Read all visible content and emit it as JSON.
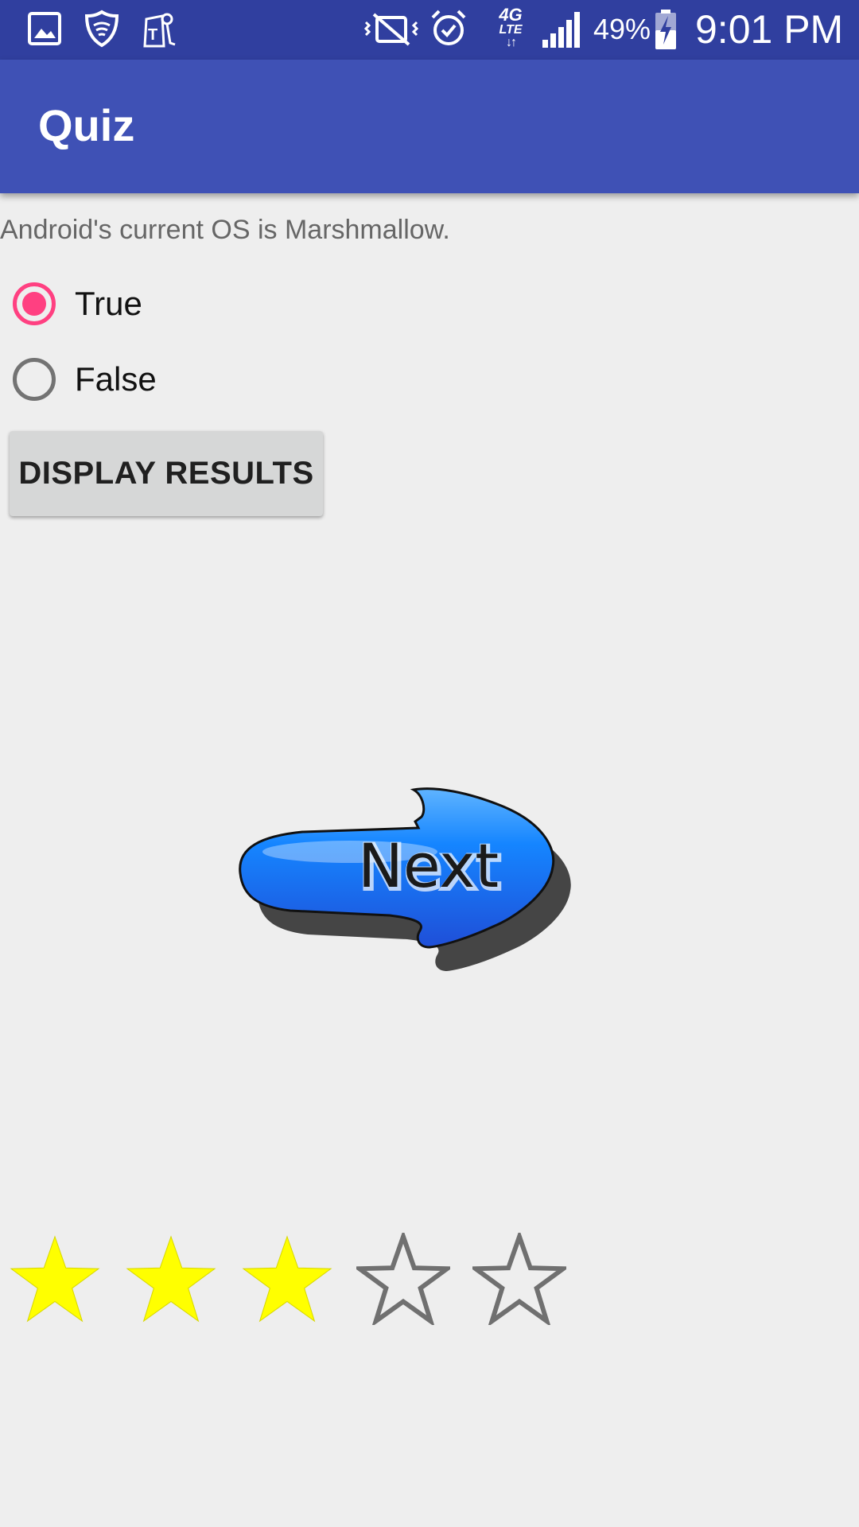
{
  "status_bar": {
    "battery_percent": "49%",
    "time": "9:01 PM",
    "network_label_top": "4G",
    "network_label_bottom": "LTE",
    "icons": [
      "gallery-icon",
      "lookout-shield-icon",
      "tmobile-icon",
      "mute-vibrate-icon",
      "alarm-icon",
      "4g-lte-icon",
      "signal-icon",
      "battery-charging-icon"
    ]
  },
  "app_bar": {
    "title": "Quiz"
  },
  "question": {
    "text": "Android's current OS is Marshmallow."
  },
  "options": [
    {
      "label": "True",
      "checked": true
    },
    {
      "label": "False",
      "checked": false
    }
  ],
  "display_button": {
    "label": "DISPLAY RESULTS"
  },
  "next_button": {
    "label": "Next",
    "color": "#1e88ff"
  },
  "rating": {
    "value": 3,
    "max": 5,
    "filled_color": "#ffff00",
    "empty_color": "#707070"
  },
  "colors": {
    "status_bar": "#303f9f",
    "app_bar": "#3f51b5",
    "accent": "#ff4081",
    "background": "#eeeeee"
  }
}
